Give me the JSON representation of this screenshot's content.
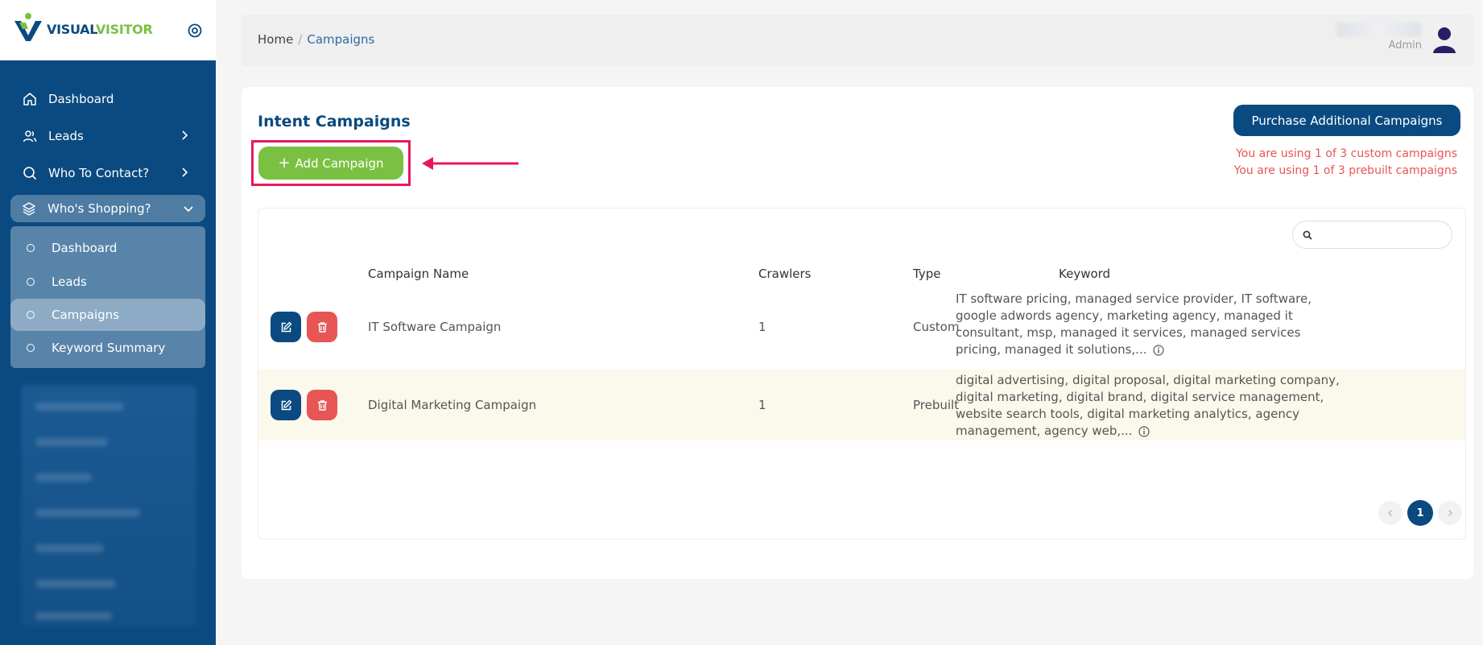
{
  "app": {
    "logo_part1": "VISUAL",
    "logo_part2": "VISITOR"
  },
  "sidebar": {
    "items": [
      {
        "label": "Dashboard",
        "icon": "home-icon"
      },
      {
        "label": "Leads",
        "icon": "users-icon"
      },
      {
        "label": "Who To Contact?",
        "icon": "search-icon"
      },
      {
        "label": "Who's Shopping?",
        "icon": "layers-icon"
      }
    ],
    "submenu": [
      {
        "label": "Dashboard"
      },
      {
        "label": "Leads"
      },
      {
        "label": "Campaigns",
        "active": true
      },
      {
        "label": "Keyword Summary"
      }
    ]
  },
  "header": {
    "breadcrumb": {
      "home": "Home",
      "separator": "/",
      "current": "Campaigns"
    },
    "user": {
      "role": "Admin"
    }
  },
  "main": {
    "title": "Intent Campaigns",
    "add_button": {
      "plus": "+",
      "label": "Add Campaign"
    },
    "purchase_button": "Purchase Additional Campaigns",
    "usage": {
      "custom": "You are using 1 of 3 custom campaigns",
      "prebuilt": "You are using 1 of 3 prebuilt campaigns"
    },
    "table": {
      "columns": [
        "Campaign Name",
        "Crawlers",
        "Type",
        "Keyword"
      ],
      "rows": [
        {
          "name": "IT Software Campaign",
          "crawlers": "1",
          "type": "Custom",
          "keyword": "IT software pricing, managed service provider, IT software, google adwords agency, marketing agency, managed it consultant, msp, managed it services, managed services pricing, managed it solutions,..."
        },
        {
          "name": "Digital Marketing Campaign",
          "crawlers": "1",
          "type": "Prebuilt",
          "keyword": "digital advertising, digital proposal, digital marketing company, digital marketing, digital brand, digital service management, website search tools, digital marketing analytics, agency management, agency web,..."
        }
      ]
    },
    "pagination": {
      "current": "1"
    }
  },
  "colors": {
    "primary": "#0a4a80",
    "accent_green": "#7ac143",
    "danger": "#e85555",
    "highlight": "#e8175d"
  }
}
